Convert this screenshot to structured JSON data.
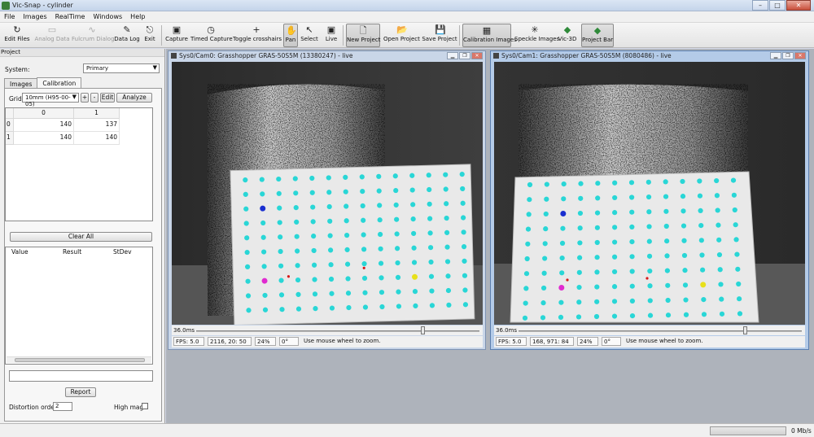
{
  "window": {
    "title": "Vic-Snap - cylinder",
    "buttons": [
      "–",
      "□",
      "✕"
    ]
  },
  "menu": [
    "File",
    "Images",
    "RealTime",
    "Windows",
    "Help"
  ],
  "toolbar": {
    "items": [
      {
        "label": "Edit Files",
        "icon": "↻",
        "enabled": true,
        "active": false
      },
      {
        "label": "Analog Data",
        "icon": "▭",
        "enabled": false,
        "active": false
      },
      {
        "label": "Fulcrum Dialog",
        "icon": "∿",
        "enabled": false,
        "active": false
      },
      {
        "label": "Data Log",
        "icon": "✎",
        "enabled": true,
        "active": false
      },
      {
        "label": "Exit",
        "icon": "⎋",
        "enabled": true,
        "active": false
      },
      {
        "label": "Capture",
        "icon": "▣",
        "enabled": true,
        "active": false
      },
      {
        "label": "Timed Capture",
        "icon": "◷",
        "enabled": true,
        "active": false
      },
      {
        "label": "Toggle crosshairs",
        "icon": "+",
        "enabled": true,
        "active": false
      },
      {
        "label": "Pan",
        "icon": "✋",
        "enabled": true,
        "active": true
      },
      {
        "label": "Select",
        "icon": "↖",
        "enabled": true,
        "active": false
      },
      {
        "label": "Live",
        "icon": "▣",
        "enabled": true,
        "active": false
      },
      {
        "label": "New Project",
        "icon": "🗋",
        "enabled": true,
        "active": false
      },
      {
        "label": "Open Project",
        "icon": "📂",
        "enabled": true,
        "active": false
      },
      {
        "label": "Save Project",
        "icon": "💾",
        "enabled": true,
        "active": false
      },
      {
        "label": "Calibration Images",
        "icon": "▦",
        "enabled": true,
        "active": true
      },
      {
        "label": "Speckle Images",
        "icon": "✳",
        "enabled": true,
        "active": false
      },
      {
        "label": "Vic-3D",
        "icon": "◆",
        "enabled": true,
        "active": false
      },
      {
        "label": "Project Bar",
        "icon": "◆",
        "enabled": true,
        "active": true
      }
    ]
  },
  "project_panel": {
    "title": "Project",
    "system_label": "System:",
    "system_value": "Primary",
    "tabs": [
      "Images",
      "Calibration"
    ],
    "active_tab": "Calibration",
    "grid_label": "Grid:",
    "grid_value": "10mm (H95-00-05)",
    "plus_label": "+",
    "minus_label": "-",
    "edit_label": "Edit",
    "analyze_label": "Analyze",
    "table": {
      "columns": [
        "0",
        "1"
      ],
      "rows": [
        {
          "header": "0",
          "cells": [
            "140",
            "137"
          ]
        },
        {
          "header": "1",
          "cells": [
            "140",
            "140"
          ]
        }
      ]
    },
    "clear_all_label": "Clear All",
    "results_columns": [
      "Value",
      "Result",
      "StDev"
    ],
    "report_label": "Report",
    "distortion_label": "Distortion order:",
    "distortion_value": "2",
    "high_mag_label": "High mag:"
  },
  "cameras": [
    {
      "title": "Sys0/Cam0: Grasshopper GRAS-50S5M (13380247) - live",
      "exposure": "36.0ms",
      "exposure_level": 0.8,
      "fps": "FPS: 5.0",
      "coords": "2116, 20: 50",
      "zoom": "24%",
      "angle": "0°",
      "hint": "Use mouse wheel to zoom."
    },
    {
      "title": "Sys0/Cam1: Grasshopper GRAS-50S5M (8080486) - live",
      "exposure": "36.0ms",
      "exposure_level": 0.8,
      "fps": "FPS: 5.0",
      "coords": "168, 971: 84",
      "zoom": "24%",
      "angle": "0°",
      "hint": "Use mouse wheel to zoom."
    }
  ],
  "status": {
    "rate": "0 Mb/s"
  },
  "colors": {
    "dot": "#29d6d6",
    "blue_marker": "#1a2fd0",
    "magenta_marker": "#e02ad0",
    "yellow_marker": "#e8e01a",
    "red_marker": "#d81818"
  }
}
